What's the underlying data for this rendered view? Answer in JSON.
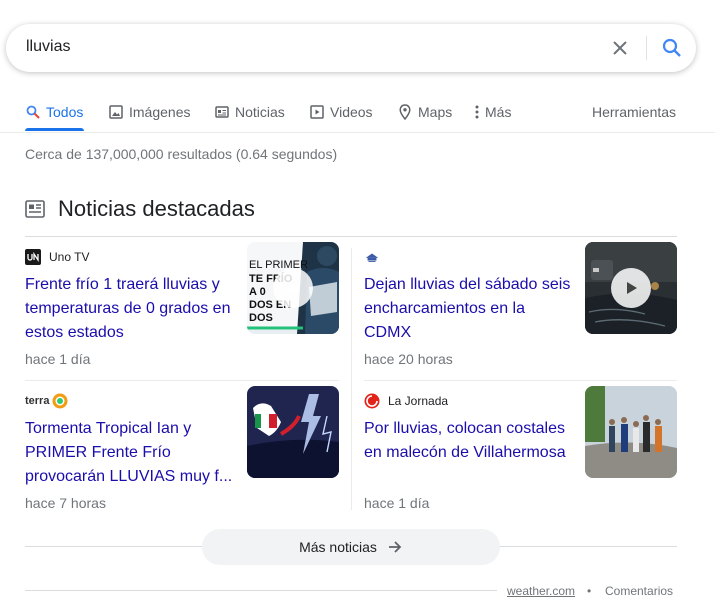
{
  "search": {
    "query": "lluvias"
  },
  "tabs": [
    {
      "label": "Todos",
      "icon": "search-icon"
    },
    {
      "label": "Imágenes",
      "icon": "image-icon"
    },
    {
      "label": "Noticias",
      "icon": "news-icon"
    },
    {
      "label": "Videos",
      "icon": "video-icon"
    },
    {
      "label": "Maps",
      "icon": "map-pin-icon"
    },
    {
      "label": "Más",
      "icon": "more-vert-icon"
    }
  ],
  "tools_label": "Herramientas",
  "result_stats": "Cerca de 137,000,000 resultados (0.64 segundos)",
  "top_stories": {
    "title": "Noticias destacadas",
    "cards": [
      {
        "source": "Uno TV",
        "headline": "Frente frío 1 traerá lluvias y temperaturas de 0 grados en estos estados",
        "time": "hace 1 día",
        "thumb_text": "EL PRIMER TE FRÍO A 0 DOS EN DOS"
      },
      {
        "source": "",
        "headline": "Dejan lluvias del sábado seis encharcamientos en la CDMX",
        "time": "hace 20 horas"
      },
      {
        "source": "terra",
        "headline": "Tormenta Tropical Ian y PRIMER Frente Frío provocarán LLUVIAS muy f...",
        "time": "hace 7 horas"
      },
      {
        "source": "La Jornada",
        "headline": "Por lluvias, colocan costales en malecón de Villahermosa",
        "time": "hace 1 día"
      }
    ],
    "more_label": "Más noticias"
  },
  "footer": {
    "source_link": "weather.com",
    "separator": "•",
    "comments_label": "Comentarios"
  },
  "colors": {
    "accent": "#1a73e8",
    "link": "#1a0dab",
    "muted": "#70757a",
    "red": "#ea4335"
  }
}
